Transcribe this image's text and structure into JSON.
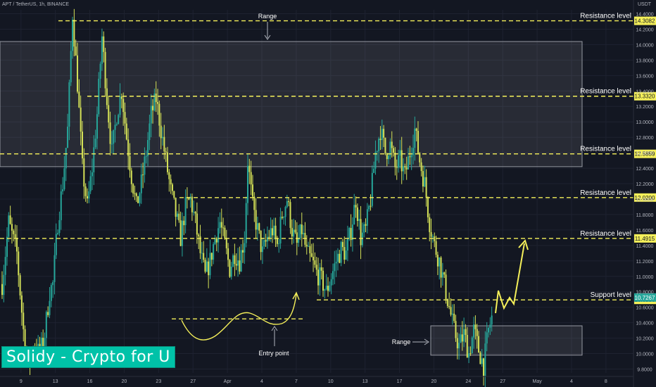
{
  "header": {
    "symbol_line": "APT / TetherUS, 1h, BINANCE",
    "unit": "USDT"
  },
  "watermark": "Solidy - Crypto for U",
  "colors": {
    "background": "#131722",
    "up": "#26a69a",
    "down": "#d4e157",
    "level_line": "#f5f05a",
    "range_fill": "#ffffff",
    "text": "#ffffff"
  },
  "chart_data": {
    "type": "candlestick",
    "x_ticks": [
      "9",
      "13",
      "16",
      "20",
      "23",
      "27",
      "Apr",
      "4",
      "7",
      "10",
      "13",
      "17",
      "20",
      "24",
      "27",
      "May",
      "4",
      "8"
    ],
    "y_ticks": [
      14.4,
      14.2,
      14.0,
      13.8,
      13.6,
      13.4,
      13.2,
      13.0,
      12.8,
      12.6,
      12.4,
      12.2,
      12.0,
      11.8,
      11.6,
      11.4,
      11.2,
      11.0,
      10.8,
      10.6,
      10.4,
      10.2,
      10.0,
      9.8
    ],
    "ylim": [
      9.75,
      14.45
    ],
    "price_path": [
      [
        0,
        10.9
      ],
      [
        4,
        11.7
      ],
      [
        9,
        11.3
      ],
      [
        13,
        10.3
      ],
      [
        16,
        9.85
      ],
      [
        19,
        10.1
      ],
      [
        23,
        10.0
      ],
      [
        26,
        10.25
      ],
      [
        29,
        10.8
      ],
      [
        31,
        10.9
      ],
      [
        34,
        11.7
      ],
      [
        37,
        12.2
      ],
      [
        40,
        12.9
      ],
      [
        43,
        14.4
      ],
      [
        46,
        13.5
      ],
      [
        49,
        12.4
      ],
      [
        52,
        11.9
      ],
      [
        55,
        12.4
      ],
      [
        58,
        13.1
      ],
      [
        61,
        14.1
      ],
      [
        64,
        13.3
      ],
      [
        67,
        12.6
      ],
      [
        70,
        13.1
      ],
      [
        73,
        13.4
      ],
      [
        76,
        12.8
      ],
      [
        79,
        12.3
      ],
      [
        82,
        11.9
      ],
      [
        85,
        12.2
      ],
      [
        88,
        12.6
      ],
      [
        91,
        13.1
      ],
      [
        94,
        13.3
      ],
      [
        97,
        12.9
      ],
      [
        100,
        12.5
      ],
      [
        103,
        12.1
      ],
      [
        106,
        11.8
      ],
      [
        109,
        11.5
      ],
      [
        112,
        11.9
      ],
      [
        115,
        12.0
      ],
      [
        118,
        11.7
      ],
      [
        121,
        11.3
      ],
      [
        124,
        11.0
      ],
      [
        127,
        11.2
      ],
      [
        130,
        11.5
      ],
      [
        133,
        11.7
      ],
      [
        136,
        11.4
      ],
      [
        139,
        11.1
      ],
      [
        142,
        11.3
      ],
      [
        145,
        11.2
      ],
      [
        148,
        11.5
      ],
      [
        150,
        12.5
      ],
      [
        153,
        11.9
      ],
      [
        156,
        11.6
      ],
      [
        159,
        11.3
      ],
      [
        162,
        11.5
      ],
      [
        165,
        11.6
      ],
      [
        168,
        11.4
      ],
      [
        171,
        11.8
      ],
      [
        174,
        12.0
      ],
      [
        177,
        11.6
      ],
      [
        180,
        11.4
      ],
      [
        183,
        11.6
      ],
      [
        186,
        11.3
      ],
      [
        189,
        11.2
      ],
      [
        192,
        11.05
      ],
      [
        195,
        10.95
      ],
      [
        198,
        10.8
      ],
      [
        201,
        11.0
      ],
      [
        204,
        11.2
      ],
      [
        207,
        11.35
      ],
      [
        210,
        11.3
      ],
      [
        213,
        11.6
      ],
      [
        216,
        12.0
      ],
      [
        219,
        11.5
      ],
      [
        222,
        11.6
      ],
      [
        225,
        12.0
      ],
      [
        228,
        12.6
      ],
      [
        231,
        12.9
      ],
      [
        234,
        12.6
      ],
      [
        237,
        12.7
      ],
      [
        240,
        12.4
      ],
      [
        243,
        12.5
      ],
      [
        246,
        12.3
      ],
      [
        249,
        12.6
      ],
      [
        252,
        12.9
      ],
      [
        255,
        12.5
      ],
      [
        258,
        12.2
      ],
      [
        261,
        11.7
      ],
      [
        264,
        11.4
      ],
      [
        267,
        11.2
      ],
      [
        270,
        10.9
      ],
      [
        273,
        10.6
      ],
      [
        276,
        10.3
      ],
      [
        279,
        10.1
      ],
      [
        282,
        10.25
      ],
      [
        285,
        10.0
      ],
      [
        288,
        10.3
      ],
      [
        291,
        10.05
      ],
      [
        294,
        9.85
      ],
      [
        297,
        10.3
      ],
      [
        300,
        10.55
      ]
    ],
    "levels": [
      {
        "value": 14.3082,
        "value_label": "14.3082",
        "label": "Resistance level",
        "kind": "resistance"
      },
      {
        "value": 13.332,
        "value_label": "13.3320",
        "label": "Resistance level",
        "kind": "resistance"
      },
      {
        "value": 12.5859,
        "value_label": "12.5859",
        "label": "Resistance level",
        "kind": "resistance"
      },
      {
        "value": 12.02,
        "value_label": "12.0200",
        "label": "Resistance level",
        "kind": "resistance"
      },
      {
        "value": 11.4915,
        "value_label": "11.4915",
        "label": "Resistance level",
        "kind": "resistance"
      },
      {
        "value": 10.6956,
        "value_label": "10.6956",
        "label": "Support level",
        "kind": "support"
      }
    ],
    "current_price": {
      "value": 10.7267,
      "label": "10.7267"
    },
    "annotations": {
      "range_top": "Range",
      "range_bottom": "Range",
      "entry_point": "Entry point"
    },
    "range_boxes": [
      {
        "price_top": 14.04,
        "price_bottom": 12.42
      },
      {
        "price_top": 10.36,
        "price_bottom": 9.98
      }
    ],
    "entry_level": 10.45
  }
}
